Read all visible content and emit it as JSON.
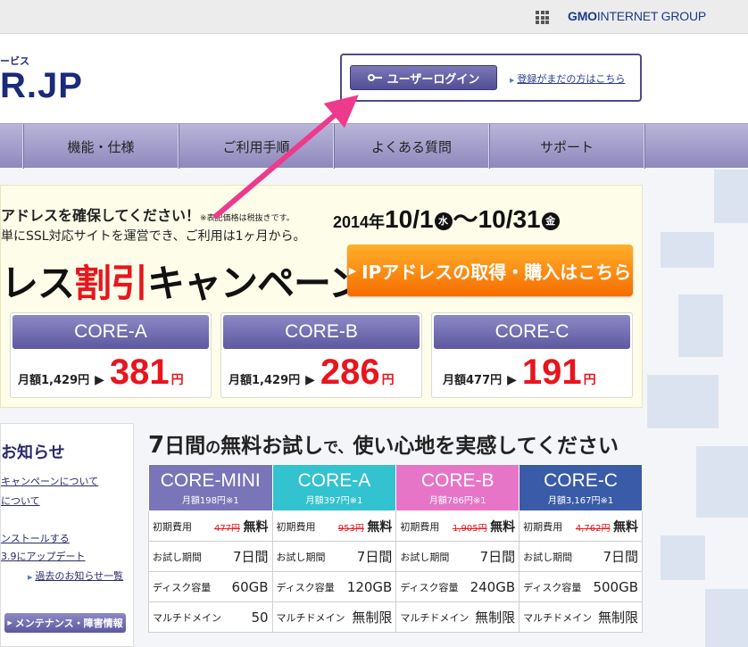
{
  "topbar": {
    "brand_gmo": "GMO",
    "brand_rest": "INTERNET GROUP"
  },
  "header": {
    "logo_sub": "ービス",
    "logo_main": "R.JP",
    "login_button": "ユーザーログイン",
    "register_link": "登録がまだの方はこちら"
  },
  "nav": {
    "items": [
      "機能・仕様",
      "ご利用手順",
      "よくある質問",
      "サポート"
    ]
  },
  "banner": {
    "line1": "アドレスを確保してください！",
    "line1_note": "※表記価格は税抜きです。",
    "line2": "単にSSL対応サイトを運営でき、ご利用は1ヶ月から。",
    "date_year": "2014年",
    "date_start": "10/1",
    "dow_start": "水",
    "date_sep": "～",
    "date_end": "10/31",
    "dow_end": "金",
    "title_a": "レス",
    "title_b": "割引",
    "title_c": "キャンペーン",
    "cta": "IPアドレスの取得・購入はこちら",
    "plans": [
      {
        "name": "CORE-A",
        "regular": "月額1,429円",
        "price": "381",
        "unit": "円"
      },
      {
        "name": "CORE-B",
        "regular": "月額1,429円",
        "price": "286",
        "unit": "円"
      },
      {
        "name": "CORE-C",
        "regular": "月額477円",
        "price": "191",
        "unit": "円"
      }
    ]
  },
  "news": {
    "title": "お知らせ",
    "items": [
      "キャンペーンについて",
      "について",
      "ンストールする",
      "3.9にアップデート"
    ],
    "more": "過去のお知らせ一覧",
    "maintenance": "メンテナンス・障害情報"
  },
  "trial": {
    "title_a": "7",
    "title_b": "日間",
    "title_c": "の",
    "title_d": "無料お試し",
    "title_e": "で、",
    "title_f": "使い心地を実感してください",
    "plans": [
      {
        "name": "CORE-MINI",
        "price": "月額198円",
        "note": "※1",
        "color": "#7a74b8"
      },
      {
        "name": "CORE-A",
        "price": "月額397円",
        "note": "※1",
        "color": "#33c2cf"
      },
      {
        "name": "CORE-B",
        "price": "月額786円",
        "note": "※1",
        "color": "#e675c8"
      },
      {
        "name": "CORE-C",
        "price": "月額3,167円",
        "note": "※1",
        "color": "#3a5ba8"
      }
    ],
    "rows": [
      {
        "label": "初期費用",
        "values": [
          {
            "old": "477円",
            "val": "無料"
          },
          {
            "old": "953円",
            "val": "無料"
          },
          {
            "old": "1,905円",
            "val": "無料"
          },
          {
            "old": "4,762円",
            "val": "無料"
          }
        ]
      },
      {
        "label": "お試し期間",
        "values": [
          {
            "val": "7日間"
          },
          {
            "val": "7日間"
          },
          {
            "val": "7日間"
          },
          {
            "val": "7日間"
          }
        ]
      },
      {
        "label": "ディスク容量",
        "values": [
          {
            "val": "60GB"
          },
          {
            "val": "120GB"
          },
          {
            "val": "240GB"
          },
          {
            "val": "500GB"
          }
        ]
      },
      {
        "label": "マルチドメイン",
        "values": [
          {
            "val": "50"
          },
          {
            "val": "無制限"
          },
          {
            "val": "無制限"
          },
          {
            "val": "無制限"
          }
        ]
      }
    ]
  }
}
